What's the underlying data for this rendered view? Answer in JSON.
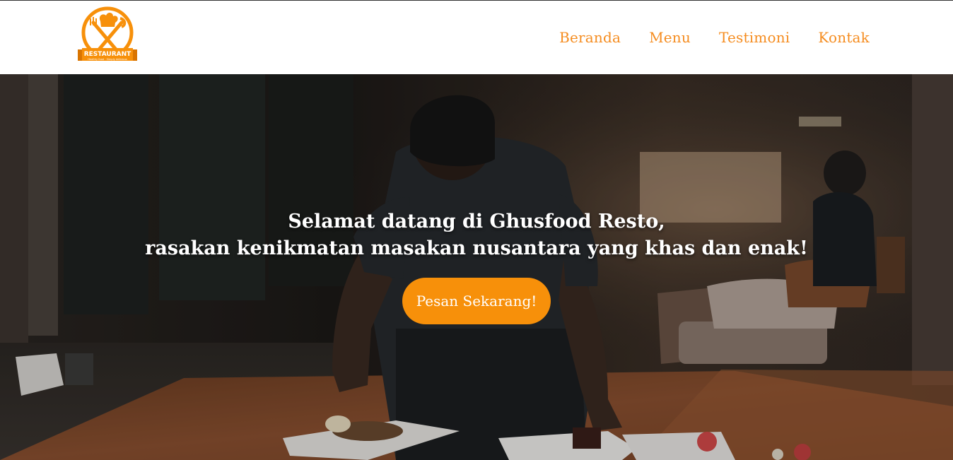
{
  "logo": {
    "banner_text": "RESTAURANT",
    "tagline": "Healthy food · Simply delicious",
    "icon": "chef-hat-fork-knife-logo"
  },
  "nav": {
    "items": [
      {
        "label": "Beranda"
      },
      {
        "label": "Menu"
      },
      {
        "label": "Testimoni"
      },
      {
        "label": "Kontak"
      }
    ]
  },
  "hero": {
    "title_line1": "Selamat datang di Ghusfood Resto,",
    "title_line2": "rasakan kenikmatan masakan nusantara yang khas dan enak!",
    "cta_label": "Pesan Sekarang!",
    "background": "chef-plating-food-in-restaurant-photo"
  },
  "colors": {
    "accent": "#f58c1f",
    "button": "#f7900a",
    "header_bg": "#ffffff"
  }
}
